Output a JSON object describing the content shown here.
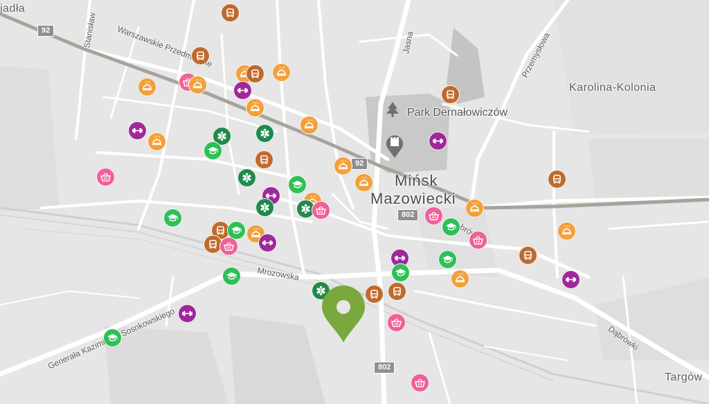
{
  "map": {
    "places": {
      "city_line1": "Mińsk",
      "city_line2": "Mazowiecki",
      "park": "Park Dernałowiczów",
      "karolina": "Karolina-Kolonia",
      "jadla": "jadła",
      "targow": "Targów"
    },
    "streets": {
      "warszawskie": "Warszawskie Przedmieście",
      "stanislaw": "Stanisław",
      "jasna": "Jasna",
      "przemyslowa": "Przemysłowa",
      "mrozowska": "Mrozowska",
      "generala": "Generała Kazimierza Sosnkowskiego",
      "dabrowki1": "Dąbrówki",
      "dabrowki2": "Dąbrówki"
    },
    "shields": {
      "r92_a": "92",
      "r92_b": "92",
      "r802_a": "802",
      "r802_b": "802"
    },
    "category_colors": {
      "transport": "#bf6a2c",
      "food": "#f2a03a",
      "shopping": "#f0609a",
      "fitness": "#a0289b",
      "health": "#1f8a4c",
      "education": "#2fbf57",
      "pin": "#7aa83c"
    },
    "marker_icons": {
      "transport": "bus-icon",
      "food": "restaurant-cloche-icon",
      "shopping": "basket-icon",
      "fitness": "dumbbell-icon",
      "health": "medical-star-icon",
      "education": "graduation-cap-icon"
    },
    "selected_pin": "location-pin-icon"
  }
}
